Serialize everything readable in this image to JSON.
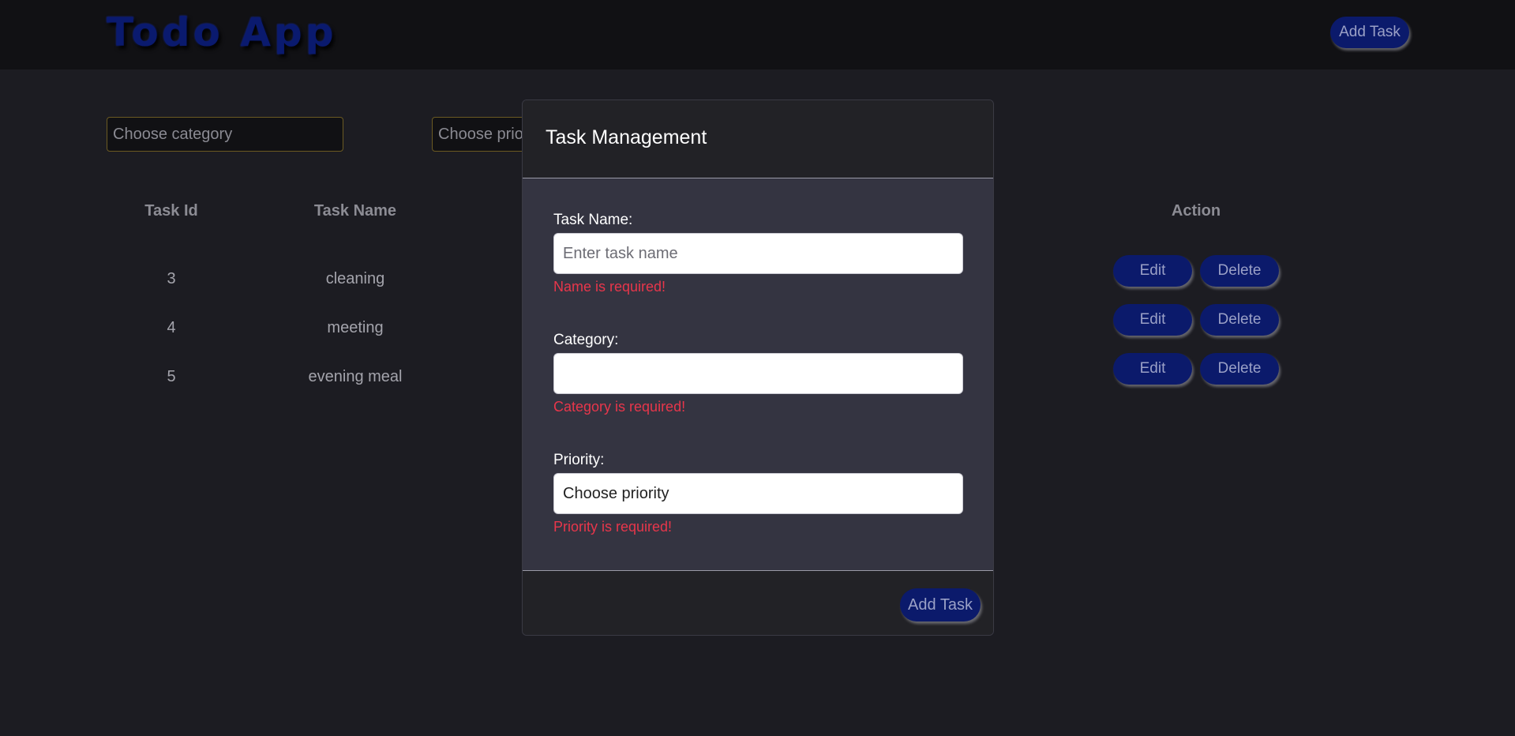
{
  "header": {
    "app_title": "Todo App",
    "add_task_label": "Add Task"
  },
  "filters": {
    "category_placeholder": "Choose category",
    "priority_placeholder": "Choose prio"
  },
  "table": {
    "headers": {
      "id": "Task Id",
      "name": "Task Name",
      "action": "Action"
    },
    "rows": [
      {
        "id": "3",
        "name": "cleaning",
        "edit": "Edit",
        "delete": "Delete"
      },
      {
        "id": "4",
        "name": "meeting",
        "edit": "Edit",
        "delete": "Delete"
      },
      {
        "id": "5",
        "name": "evening meal",
        "edit": "Edit",
        "delete": "Delete"
      }
    ]
  },
  "modal": {
    "title": "Task Management",
    "task_name": {
      "label": "Task Name:",
      "placeholder": "Enter task name",
      "error": "Name is required!"
    },
    "category": {
      "label": "Category:",
      "value": "",
      "error": "Category is required!"
    },
    "priority": {
      "label": "Priority:",
      "selected": "Choose priority",
      "error": "Priority is required!"
    },
    "submit_label": "Add Task"
  },
  "colors": {
    "background": "#1c1c22",
    "header_bg": "#111114",
    "button_bg": "#0b1a6b",
    "error_text": "#e8364b",
    "modal_body_bg": "#343441"
  }
}
